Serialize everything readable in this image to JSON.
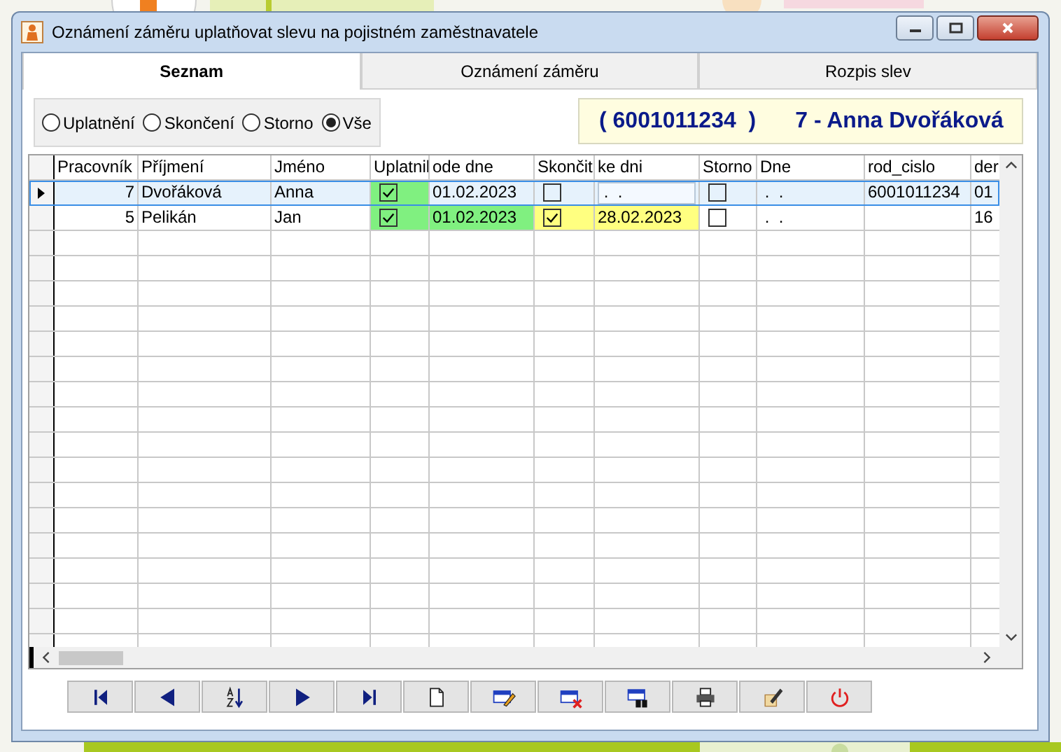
{
  "window": {
    "title": "Oznámení záměru uplatňovat slevu na pojistném zaměstnavatele"
  },
  "tabs": [
    {
      "label": "Seznam",
      "selected": true
    },
    {
      "label": "Oznámení záměru",
      "selected": false
    },
    {
      "label": "Rozpis slev",
      "selected": false
    }
  ],
  "filter": [
    {
      "label": "Uplatnění",
      "selected": false
    },
    {
      "label": "Skončení",
      "selected": false
    },
    {
      "label": "Storno",
      "selected": false
    },
    {
      "label": "Vše",
      "selected": true
    }
  ],
  "info_box": {
    "id": "( 6001011234  )",
    "person": "7 - Anna Dvořáková"
  },
  "table": {
    "columns": [
      "Pracovník",
      "Příjmení",
      "Jméno",
      "Uplatnil",
      "ode dne",
      "Skončit",
      "ke dni",
      "Storno",
      "Dne",
      "rod_cislo",
      "der"
    ],
    "rows": [
      {
        "selected": true,
        "cells": [
          {
            "kind": "number",
            "text": "7"
          },
          {
            "kind": "text",
            "text": "Dvořáková"
          },
          {
            "kind": "text",
            "text": "Anna"
          },
          {
            "kind": "check",
            "checked": true,
            "color": "#80f080"
          },
          {
            "kind": "text",
            "text": "01.02.2023"
          },
          {
            "kind": "check",
            "checked": false
          },
          {
            "kind": "input",
            "text": " .  ."
          },
          {
            "kind": "check",
            "checked": false
          },
          {
            "kind": "text",
            "text": " .  ."
          },
          {
            "kind": "text",
            "text": "6001011234"
          },
          {
            "kind": "text",
            "text": "01"
          }
        ]
      },
      {
        "selected": false,
        "cells": [
          {
            "kind": "number",
            "text": "5"
          },
          {
            "kind": "text",
            "text": "Pelikán"
          },
          {
            "kind": "text",
            "text": "Jan"
          },
          {
            "kind": "check",
            "checked": true,
            "color": "#80f080"
          },
          {
            "kind": "text",
            "text": "01.02.2023",
            "color": "#80f080"
          },
          {
            "kind": "check",
            "checked": true,
            "color": "#ffff80"
          },
          {
            "kind": "text",
            "text": "28.02.2023",
            "color": "#ffff80"
          },
          {
            "kind": "check",
            "checked": false
          },
          {
            "kind": "text",
            "text": " .  ."
          },
          {
            "kind": "text",
            "text": ""
          },
          {
            "kind": "text",
            "text": "16"
          }
        ]
      }
    ]
  },
  "toolbar": [
    {
      "kind": "first"
    },
    {
      "kind": "prev"
    },
    {
      "kind": "sort"
    },
    {
      "kind": "next"
    },
    {
      "kind": "last"
    },
    {
      "kind": "new"
    },
    {
      "kind": "edit"
    },
    {
      "kind": "delete"
    },
    {
      "kind": "find"
    },
    {
      "kind": "print"
    },
    {
      "kind": "tools"
    },
    {
      "kind": "power"
    }
  ]
}
